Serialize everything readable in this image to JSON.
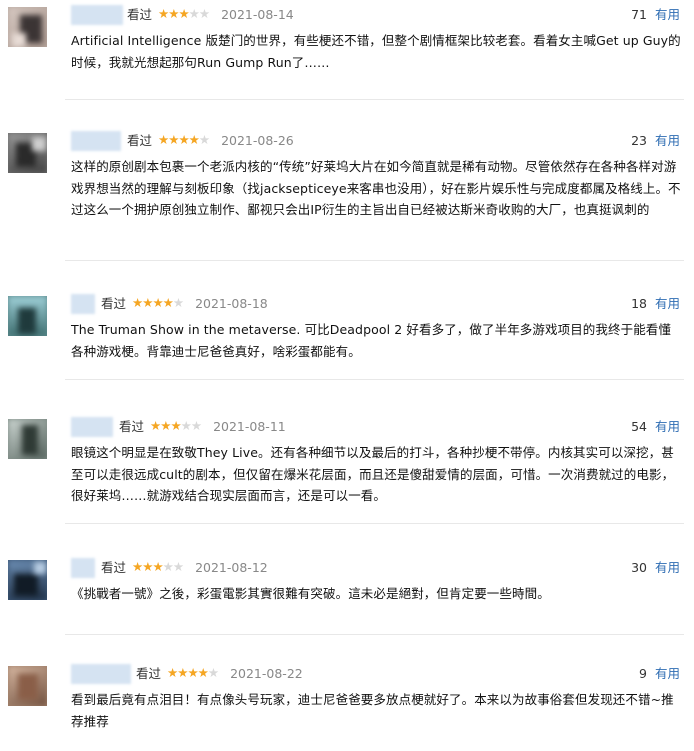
{
  "reviews": [
    {
      "watched": "看过",
      "rating": 3,
      "date": "2021-08-14",
      "votes": "71",
      "useful": "有用",
      "text": "Artificial Intelligence 版楚门的世界，有些梗还不错，但整个剧情框架比较老套。看着女主喊Get up Guy的时候，我就光想起那句Run Gump Run了……"
    },
    {
      "watched": "看过",
      "rating": 4,
      "date": "2021-08-26",
      "votes": "23",
      "useful": "有用",
      "text": "这样的原创剧本包裹一个老派内核的“传统”好莱坞大片在如今简直就是稀有动物。尽管依然存在各种各样对游戏界想当然的理解与刻板印象（找jacksepticeye来客串也没用），好在影片娱乐性与完成度都属及格线上。不过这么一个拥护原创独立制作、鄙视只会出IP衍生的主旨出自已经被达斯米奇收购的大厂，也真挺讽刺的"
    },
    {
      "watched": "看过",
      "rating": 4,
      "date": "2021-08-18",
      "votes": "18",
      "useful": "有用",
      "text": "The Truman Show in the metaverse. 可比Deadpool 2 好看多了，做了半年多游戏项目的我终于能看懂各种游戏梗。背靠迪士尼爸爸真好，啥彩蛋都能有。"
    },
    {
      "watched": "看过",
      "rating": 3,
      "date": "2021-08-11",
      "votes": "54",
      "useful": "有用",
      "text": "眼镜这个明显是在致敬They Live。还有各种细节以及最后的打斗，各种抄梗不带停。内核其实可以深挖，甚至可以走很远成cult的剧本，但仅留在爆米花层面，而且还是傻甜爱情的层面，可惜。一次消费就过的电影，很好莱坞……就游戏结合现实层面而言，还是可以一看。"
    },
    {
      "watched": "看过",
      "rating": 3,
      "date": "2021-08-12",
      "votes": "30",
      "useful": "有用",
      "text": "《挑戰者一號》之後，彩蛋電影其實很難有突破。這未必是絕對，但肯定要一些時間。"
    },
    {
      "watched": "看过",
      "rating": 4,
      "date": "2021-08-22",
      "votes": "9",
      "useful": "有用",
      "text": "看到最后竟有点泪目！有点像头号玩家，迪士尼爸爸要多放点梗就好了。本来以为故事俗套但发现还不错~推荐推荐"
    }
  ]
}
